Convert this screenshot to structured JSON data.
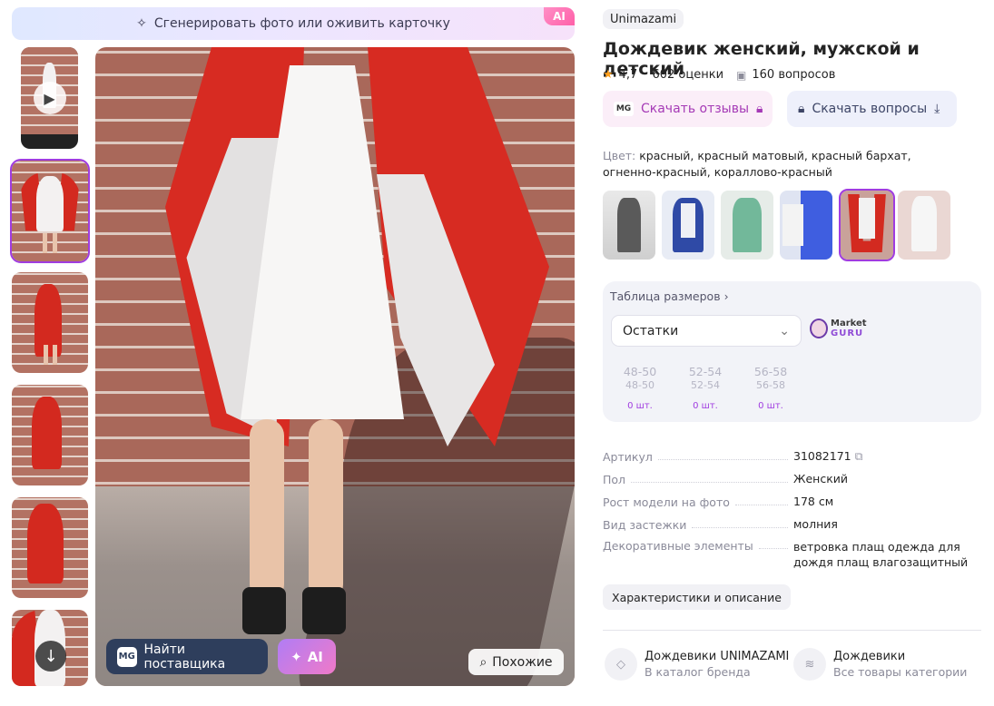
{
  "banner": {
    "text": "Сгенерировать фото или оживить карточку",
    "ai_badge": "AI"
  },
  "photo_actions": {
    "find_supplier": "Найти поставщика",
    "mg_logo": "MG",
    "ai_label": "AI",
    "similar": "Похожие"
  },
  "product": {
    "brand": "Unimazami",
    "title": "Дождевик женский, мужской и детский",
    "rating": "4,7",
    "reviews": "602 оценки",
    "questions": "160 вопросов",
    "download_reviews": "Скачать отзывы",
    "download_questions": "Скачать вопросы",
    "mg_logo": "MG"
  },
  "color": {
    "label": "Цвет:",
    "value": "красный, красный матовый, красный бархат, огненно-красный, кораллово-красный"
  },
  "sizes": {
    "table_link": "Таблица размеров",
    "stock_select": "Остатки",
    "market_guru_line1": "Market",
    "market_guru_line2": "GURU",
    "columns": [
      {
        "size": "48-50",
        "ru": "48-50",
        "count": "0 шт."
      },
      {
        "size": "52-54",
        "ru": "52-54",
        "count": "0 шт."
      },
      {
        "size": "56-58",
        "ru": "56-58",
        "count": "0 шт."
      }
    ]
  },
  "specs": [
    {
      "key": "Артикул",
      "value": "31082171"
    },
    {
      "key": "Пол",
      "value": "Женский"
    },
    {
      "key": "Рост модели на фото",
      "value": "178 см"
    },
    {
      "key": "Вид застежки",
      "value": "молния"
    },
    {
      "key": "Декоративные элементы",
      "value": "ветровка плащ одежда для дождя плащ влагозащитный"
    }
  ],
  "characteristics_button": "Характеристики и описание",
  "categories": [
    {
      "title": "Дождевики UNIMAZAMI",
      "subtitle": "В каталог бренда"
    },
    {
      "title": "Дождевики",
      "subtitle": "Все товары категории"
    }
  ],
  "accent_color": "#a03ce0"
}
